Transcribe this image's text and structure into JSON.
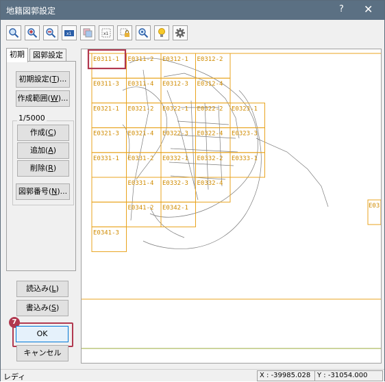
{
  "window": {
    "title": "地籍図郭設定",
    "help_label": "?",
    "close_label": "✕"
  },
  "toolbar": {
    "icons": [
      "zoom-fit-icon",
      "zoom-in-icon",
      "zoom-out-icon",
      "move-icon",
      "layer-icon",
      "grid-icon",
      "lock-icon",
      "zoom-search-icon",
      "bulb-icon",
      "gear-icon"
    ]
  },
  "tabs": [
    {
      "label": "初期",
      "active": true
    },
    {
      "label": "図郭設定",
      "active": false
    }
  ],
  "buttons": {
    "initial_settings": {
      "text": "初期設定(",
      "key": "T",
      "suffix": ")..."
    },
    "create_range": {
      "text": "作成範囲(",
      "key": "W",
      "suffix": ")..."
    },
    "create": {
      "text": "作成(",
      "key": "C",
      "suffix": ")"
    },
    "add": {
      "text": "追加(",
      "key": "A",
      "suffix": ")"
    },
    "delete": {
      "text": "削除(",
      "key": "R",
      "suffix": ")"
    },
    "sheet_number": {
      "text": "図郭番号(",
      "key": "N",
      "suffix": ")..."
    },
    "load": {
      "text": "読込み(",
      "key": "L",
      "suffix": ")"
    },
    "save": {
      "text": "書込み(",
      "key": "S",
      "suffix": ")"
    },
    "ok": "OK",
    "cancel": "キャンセル"
  },
  "scale_group": {
    "label": "1/5000"
  },
  "step_badge": "7",
  "map": {
    "colors": {
      "grid": "#e8a31c",
      "label": "#d08b00",
      "highlight": "#b1384f",
      "lines": "#6e6e6e"
    },
    "cells": [
      {
        "label": "E0311-1",
        "col": 0,
        "row": 0
      },
      {
        "label": "E0311-2",
        "col": 1,
        "row": 0
      },
      {
        "label": "E0312-1",
        "col": 2,
        "row": 0
      },
      {
        "label": "E0312-2",
        "col": 3,
        "row": 0
      },
      {
        "label": "E0311-3",
        "col": 0,
        "row": 1
      },
      {
        "label": "E0311-4",
        "col": 1,
        "row": 1
      },
      {
        "label": "E0312-3",
        "col": 2,
        "row": 1
      },
      {
        "label": "E0312-4",
        "col": 3,
        "row": 1
      },
      {
        "label": "E0321-1",
        "col": 0,
        "row": 2
      },
      {
        "label": "E0321-2",
        "col": 1,
        "row": 2
      },
      {
        "label": "E0322-1",
        "col": 2,
        "row": 2
      },
      {
        "label": "E0322-2",
        "col": 3,
        "row": 2
      },
      {
        "label": "E0323-1",
        "col": 4,
        "row": 2
      },
      {
        "label": "E0321-3",
        "col": 0,
        "row": 3
      },
      {
        "label": "E0321-4",
        "col": 1,
        "row": 3
      },
      {
        "label": "E0322-3",
        "col": 2,
        "row": 3
      },
      {
        "label": "E0322-4",
        "col": 3,
        "row": 3
      },
      {
        "label": "E0323-3",
        "col": 4,
        "row": 3
      },
      {
        "label": "E0331-1",
        "col": 0,
        "row": 4
      },
      {
        "label": "E0331-2",
        "col": 1,
        "row": 4
      },
      {
        "label": "E0332-1",
        "col": 2,
        "row": 4
      },
      {
        "label": "E0332-2",
        "col": 3,
        "row": 4
      },
      {
        "label": "E0333-1",
        "col": 4,
        "row": 4
      },
      {
        "label": "",
        "col": 0,
        "row": 5
      },
      {
        "label": "E0331-4",
        "col": 1,
        "row": 5
      },
      {
        "label": "E0332-3",
        "col": 2,
        "row": 5
      },
      {
        "label": "E0332-4",
        "col": 3,
        "row": 5
      },
      {
        "label": "",
        "col": 0,
        "row": 6
      },
      {
        "label": "E0341-2",
        "col": 1,
        "row": 6
      },
      {
        "label": "E0342-1",
        "col": 2,
        "row": 6
      },
      {
        "label": "E0341-3",
        "col": 0,
        "row": 7
      }
    ],
    "edge_label": "E03"
  },
  "status": {
    "main": "レディ",
    "x": "X : -39985.028",
    "y": "Y : -31054.000"
  }
}
